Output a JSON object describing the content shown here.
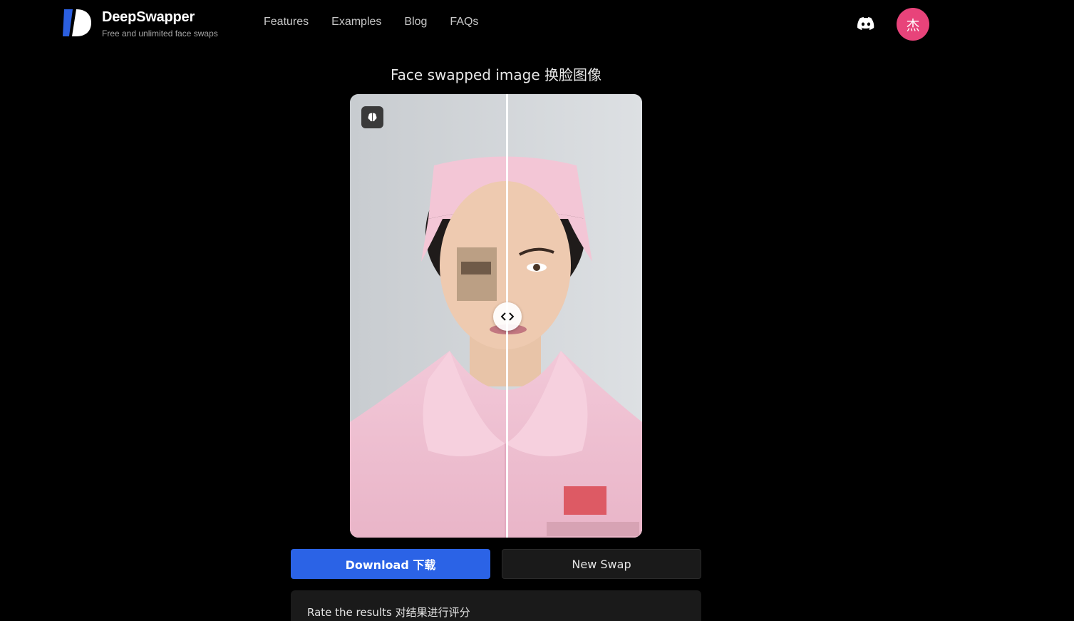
{
  "brand": {
    "name": "DeepSwapper",
    "tagline": "Free and unlimited face swaps",
    "logo_colors": [
      "#2b5fe0",
      "#ffffff"
    ]
  },
  "nav": {
    "items": [
      {
        "label": "Features"
      },
      {
        "label": "Examples"
      },
      {
        "label": "Blog"
      },
      {
        "label": "FAQs"
      }
    ]
  },
  "header_actions": {
    "discord_icon": "discord-icon",
    "avatar_initial": "杰",
    "avatar_color": "#e8437a"
  },
  "main": {
    "title": "Face swapped image 换脸图像",
    "compare": {
      "ai_badge_icon": "brain-icon",
      "handle_icon": "chevrons-left-right-icon",
      "slider_position": 0.54
    },
    "buttons": {
      "download_label": "Download 下载",
      "new_swap_label": "New Swap"
    },
    "rating": {
      "label": "Rate the results 对结果进行评分"
    }
  },
  "colors": {
    "primary": "#2b63e6",
    "background": "#000000",
    "panel": "#1a1a1a"
  }
}
